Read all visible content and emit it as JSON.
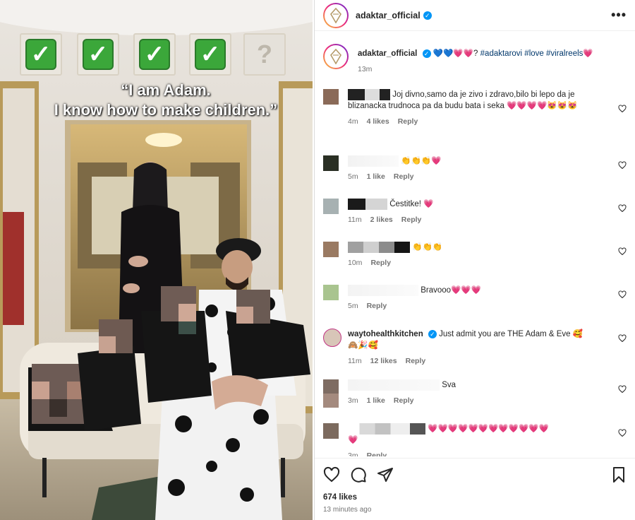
{
  "media": {
    "caption_line1": "“I am Adam.",
    "caption_line2": "I know how to make children.”",
    "checkboxes": [
      "check",
      "check",
      "check",
      "check",
      "question"
    ],
    "question_mark": "?"
  },
  "header": {
    "username": "adaktar_official",
    "more_label": "•••"
  },
  "post_caption": {
    "username": "adaktar_official",
    "text_emojis": "💙💙💗💗?",
    "hashtags": "#adaktarovi #love #viralreels",
    "end_emoji": "💗",
    "time": "13m"
  },
  "comments": [
    {
      "text": "Joj divno,samo da je zivo i zdravo,bilo bi lepo da je blizanacka trudnoca pa da budu bata i seka 💗💗💗💗😻😻😻",
      "time": "4m",
      "likes": "4 likes",
      "reply": "Reply",
      "avatar_color": "#8a6a58"
    },
    {
      "text": "👏👏👏💗",
      "time": "5m",
      "likes": "1 like",
      "reply": "Reply",
      "avatar_color": "#2a2f24"
    },
    {
      "text": "Čestitke! 💗",
      "time": "11m",
      "likes": "2 likes",
      "reply": "Reply",
      "avatar_color": "#a7b1b2"
    },
    {
      "text": "👏👏👏",
      "time": "10m",
      "likes": "",
      "reply": "Reply",
      "avatar_color": "#9a7a62"
    },
    {
      "text": "Bravooo💗💗💗",
      "time": "5m",
      "likes": "",
      "reply": "Reply",
      "avatar_color": "#a9c48f"
    },
    {
      "username": "waytohealthkitchen",
      "text": "Just admit you are THE Adam & Eve 🥰",
      "text2": "🙈🎉🥰",
      "time": "11m",
      "likes": "12 likes",
      "reply": "Reply",
      "avatar_color": "#d8c6b8"
    },
    {
      "text": "Sva",
      "time": "3m",
      "likes": "1 like",
      "reply": "Reply",
      "avatar_color": "#7e6c62"
    },
    {
      "text": "💗💗💗💗💗💗💗💗💗💗💗💗",
      "text2": "💗",
      "time": "3m",
      "likes": "",
      "reply": "Reply",
      "avatar_color": "#7c6a5e"
    }
  ],
  "footer": {
    "likes": "674 likes",
    "time_ago": "13 minutes ago"
  },
  "colors": {
    "verified": "#0095f6",
    "heart": "#ed4956",
    "hashtag": "#00376b",
    "check_green": "#3ba73a"
  }
}
